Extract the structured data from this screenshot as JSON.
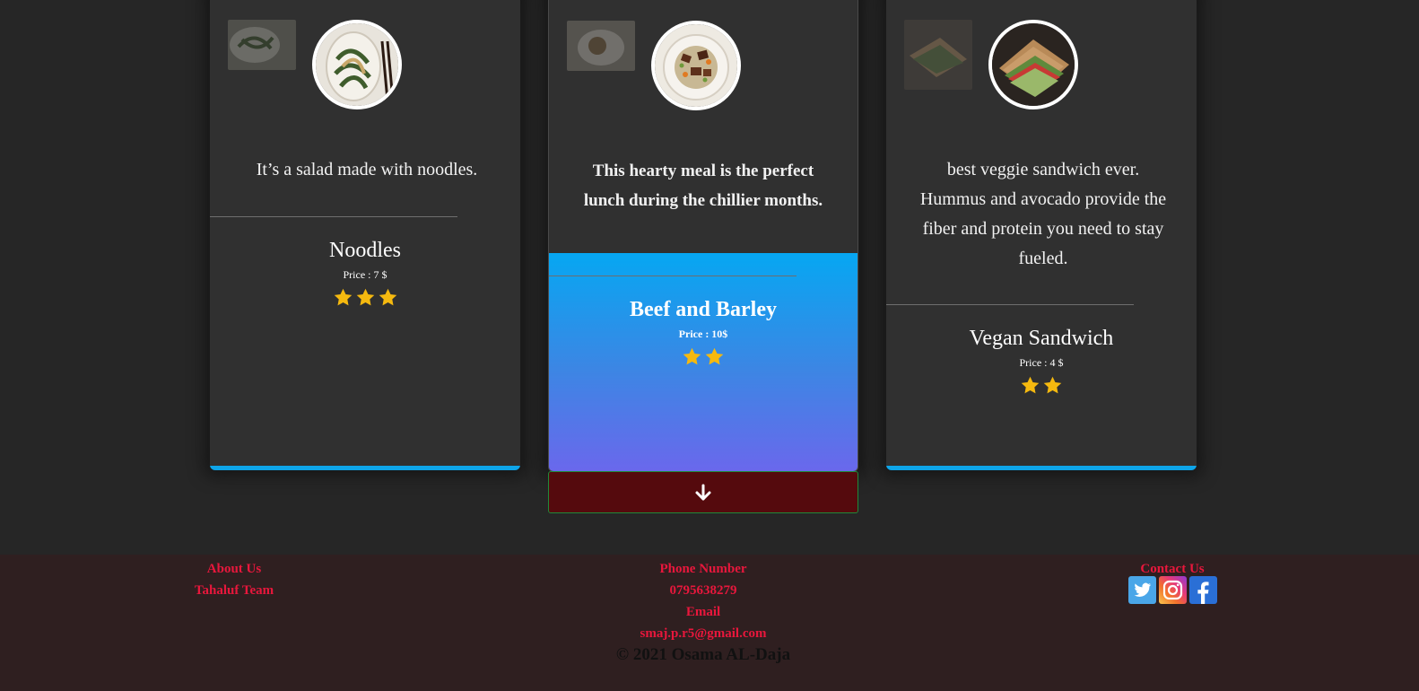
{
  "cards": [
    {
      "description": "It’s a salad made with noodles.",
      "name": "Noodles",
      "price": "Price : 7 $",
      "rating": 3
    },
    {
      "description": "This hearty meal is the perfect lunch during the chillier months.",
      "name": "Beef and Barley",
      "price": "Price : 10$",
      "rating": 2
    },
    {
      "description": "best veggie sandwich ever. Hummus and avocado provide the fiber and protein you need to stay fueled.",
      "name": "Vegan Sandwich",
      "price": "Price : 4 $",
      "rating": 2
    }
  ],
  "scroll_button": {
    "icon": "arrow-down-icon"
  },
  "footer": {
    "about_heading": "About Us",
    "about_link": "Tahaluf Team",
    "phone_heading": "Phone Number",
    "phone": "0795638279",
    "email_heading": "Email",
    "email": "smaj.p.r5@gmail.com",
    "contact_heading": "Contact Us",
    "copyright": "© 2021 Osama AL-Daja",
    "social_icons": [
      "twitter-icon",
      "instagram-icon",
      "facebook-icon"
    ]
  },
  "colors": {
    "accent": "#0ea5e9",
    "footer_text": "#e8173c",
    "star": "#f5b90f",
    "button_bg": "#550a0d"
  }
}
